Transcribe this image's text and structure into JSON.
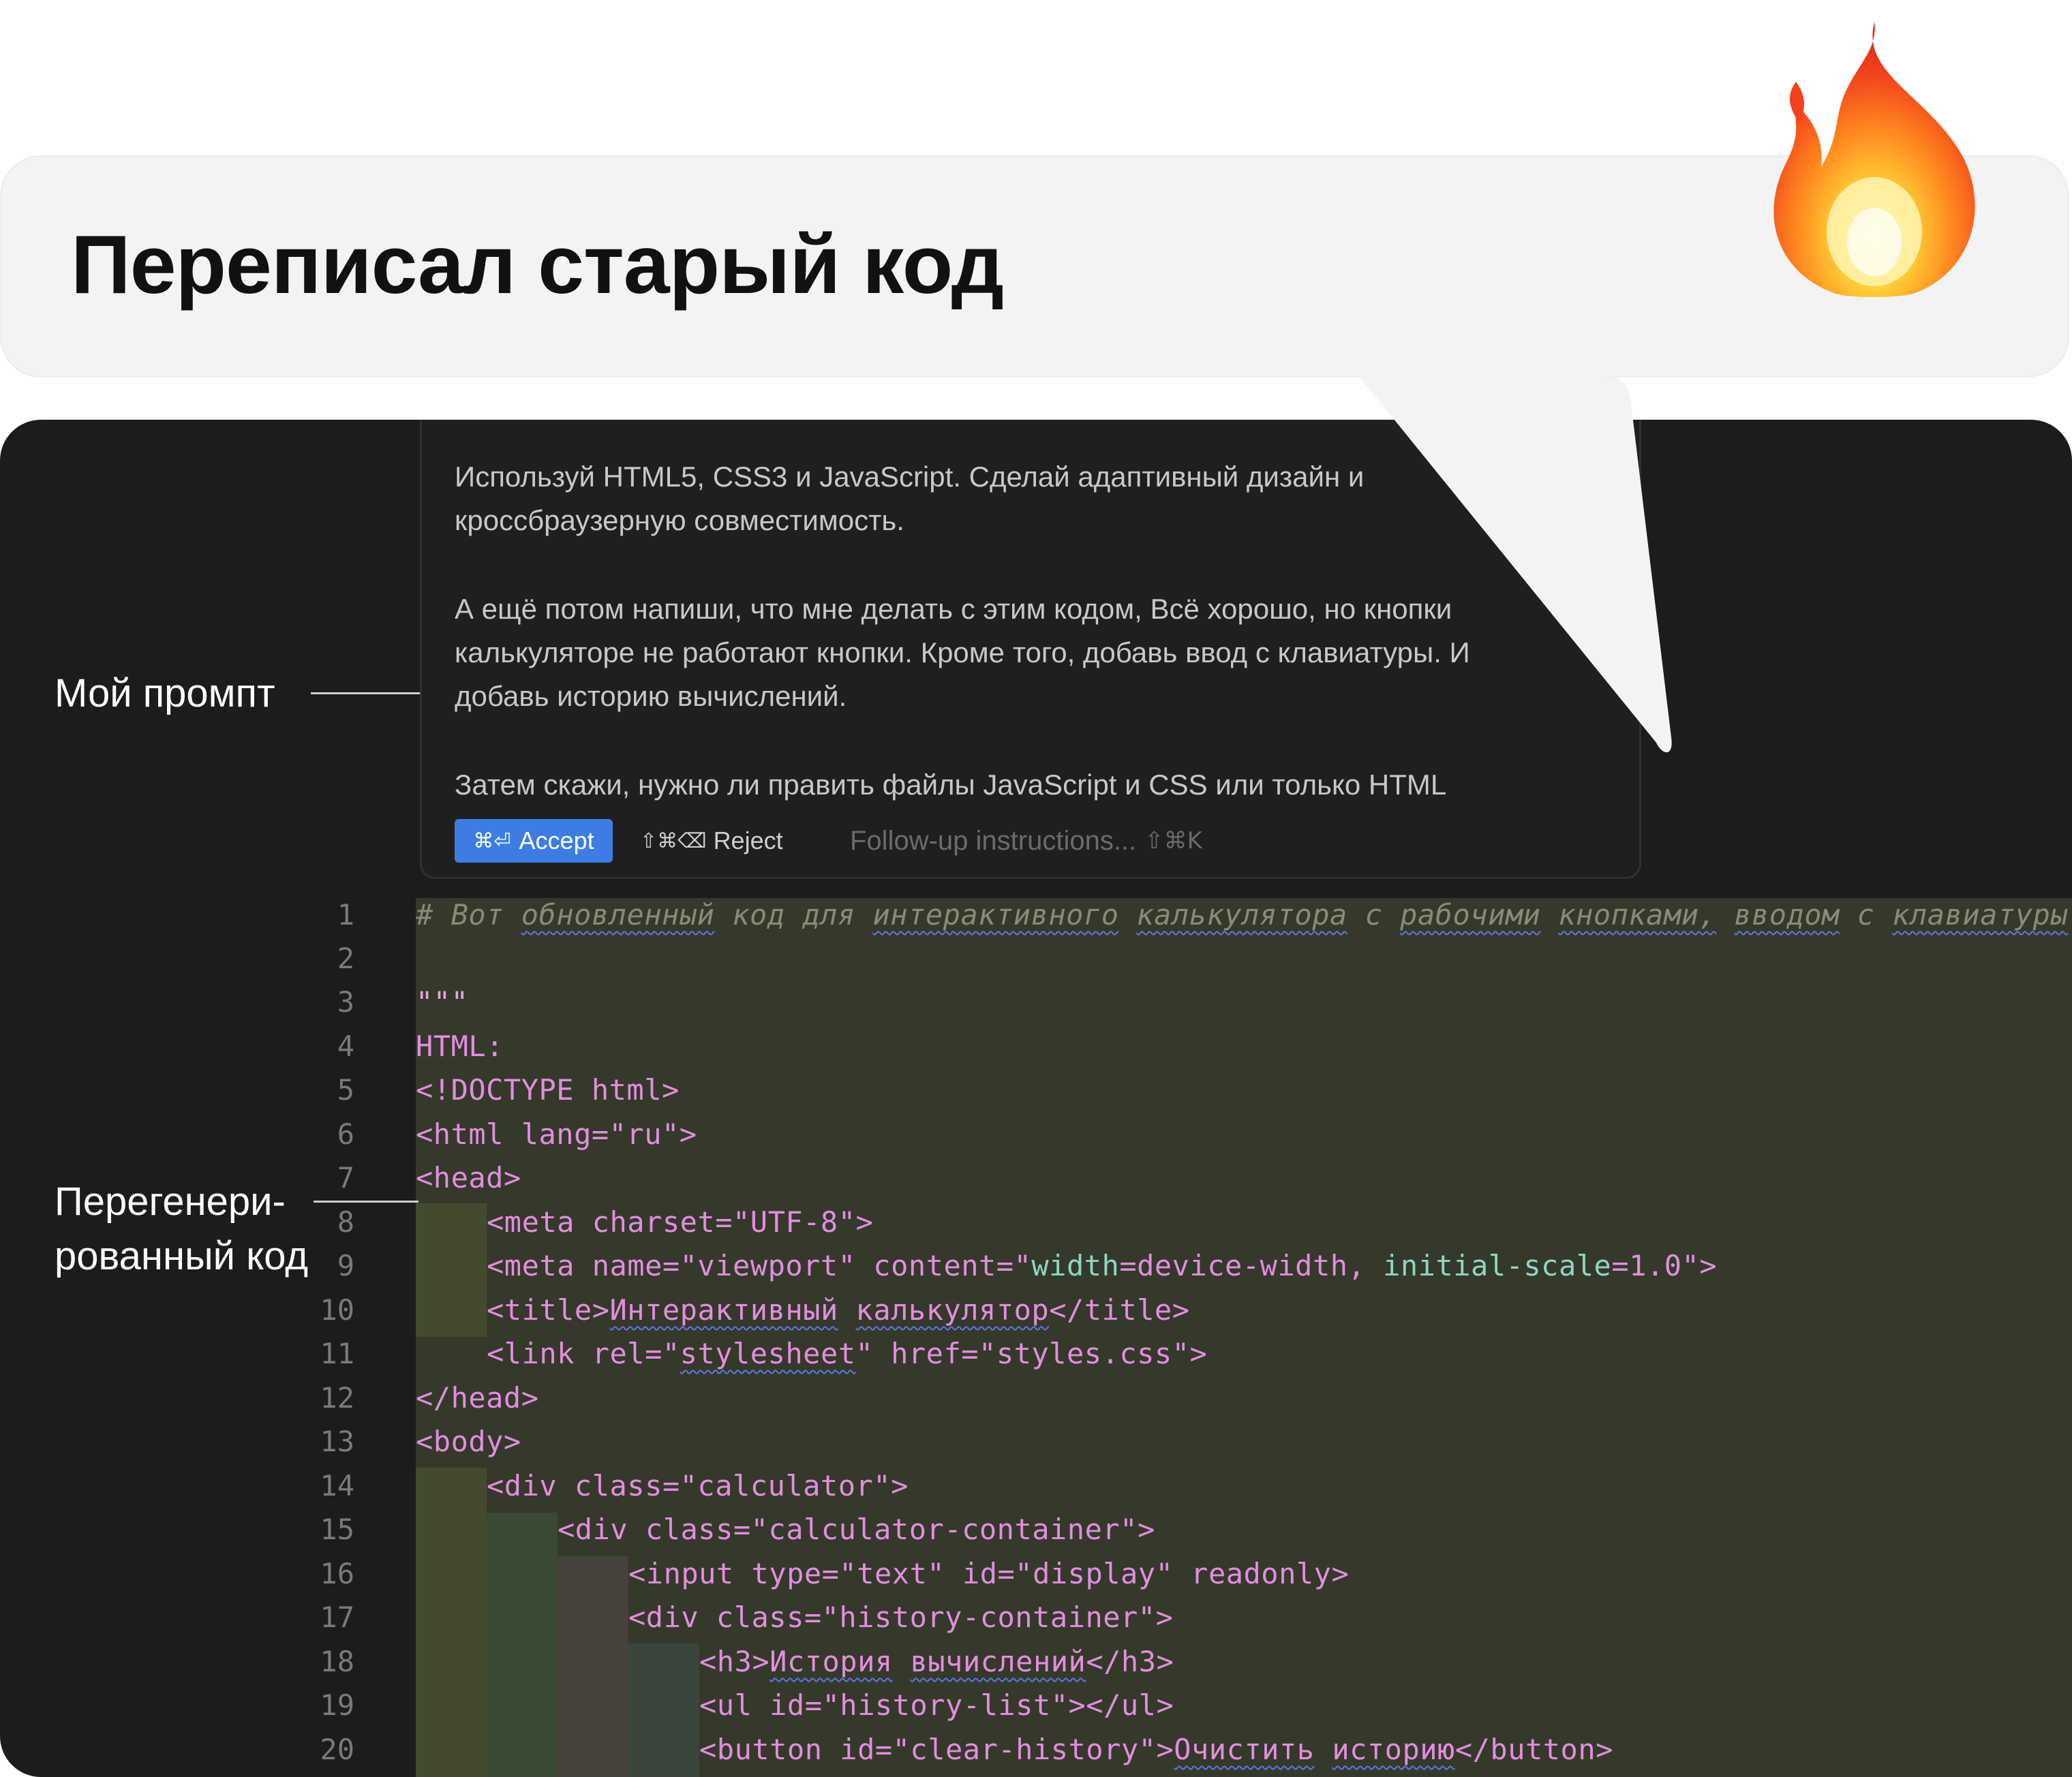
{
  "header": {
    "title": "Переписал старый код",
    "emoji": "fire-emoji"
  },
  "prompt": {
    "lines": [
      "Используй HTML5, CSS3 и JavaScript. Сделай адаптивный дизайн и",
      "кроссбраузерную совместимость.",
      "А ещё потом напиши, что мне делать с этим кодом, Всё хорошо, но кнопки",
      "калькуляторе не работают кнопки. Кроме того, добавь ввод с клавиатуры. И",
      "добавь историю вычислений.",
      "Затем скажи, нужно ли править файлы JavaScript и CSS или только HTML"
    ],
    "accept_keys": "⌘⏎",
    "accept_label": "Accept",
    "reject_keys": "⇧⌘⌫",
    "reject_label": "Reject",
    "followup_placeholder": "Follow-up instructions...",
    "followup_keys": "⇧⌘K"
  },
  "annotations": {
    "prompt_label": "Мой промпт",
    "code_label_line1": "Перегенери-",
    "code_label_line2": "рованный код"
  },
  "editor": {
    "line_numbers": [
      "1",
      "2",
      "3",
      "4",
      "5",
      "6",
      "7",
      "8",
      "9",
      "10",
      "11",
      "12",
      "13",
      "14",
      "15",
      "16",
      "17",
      "18",
      "19",
      "20"
    ],
    "code": {
      "l1": [
        "#",
        "Вот",
        "обновленный",
        "код",
        "для",
        "интерактивного",
        "калькулятора",
        "с",
        "рабочими",
        "кнопками,",
        "вводом",
        "с",
        "клавиатуры"
      ],
      "l3": "\"\"\"",
      "l4": "HTML:",
      "l5": "<!DOCTYPE html>",
      "l6": "<html lang=\"ru\">",
      "l7": "<head>",
      "l8": "<meta charset=\"UTF-8\">",
      "l9a": "<meta name=\"viewport\" content=\"",
      "l9b": "width",
      "l9c": "=device-width, ",
      "l9d": "initial-scale",
      "l9e": "=1.0\">",
      "l10a": "<title>",
      "l10b": "Интерактивный",
      "l10c": " ",
      "l10d": "калькулятор",
      "l10e": "</title>",
      "l11a": "<link rel=\"",
      "l11b": "stylesheet",
      "l11c": "\" href=\"styles.css\">",
      "l12": "</head>",
      "l13": "<body>",
      "l14": "<div class=\"calculator\">",
      "l15": "<div class=\"calculator-container\">",
      "l16": "<input type=\"text\" id=\"display\" readonly>",
      "l17": "<div class=\"history-container\">",
      "l18a": "<h3>",
      "l18b": "История",
      "l18c": " ",
      "l18d": "вычислений",
      "l18e": "</h3>",
      "l19": "<ul id=\"history-list\"></ul>",
      "l20a": "<button id=\"clear-history\">",
      "l20b": "Очистить",
      "l20c": " ",
      "l20d": "историю",
      "l20e": "</button>"
    }
  }
}
